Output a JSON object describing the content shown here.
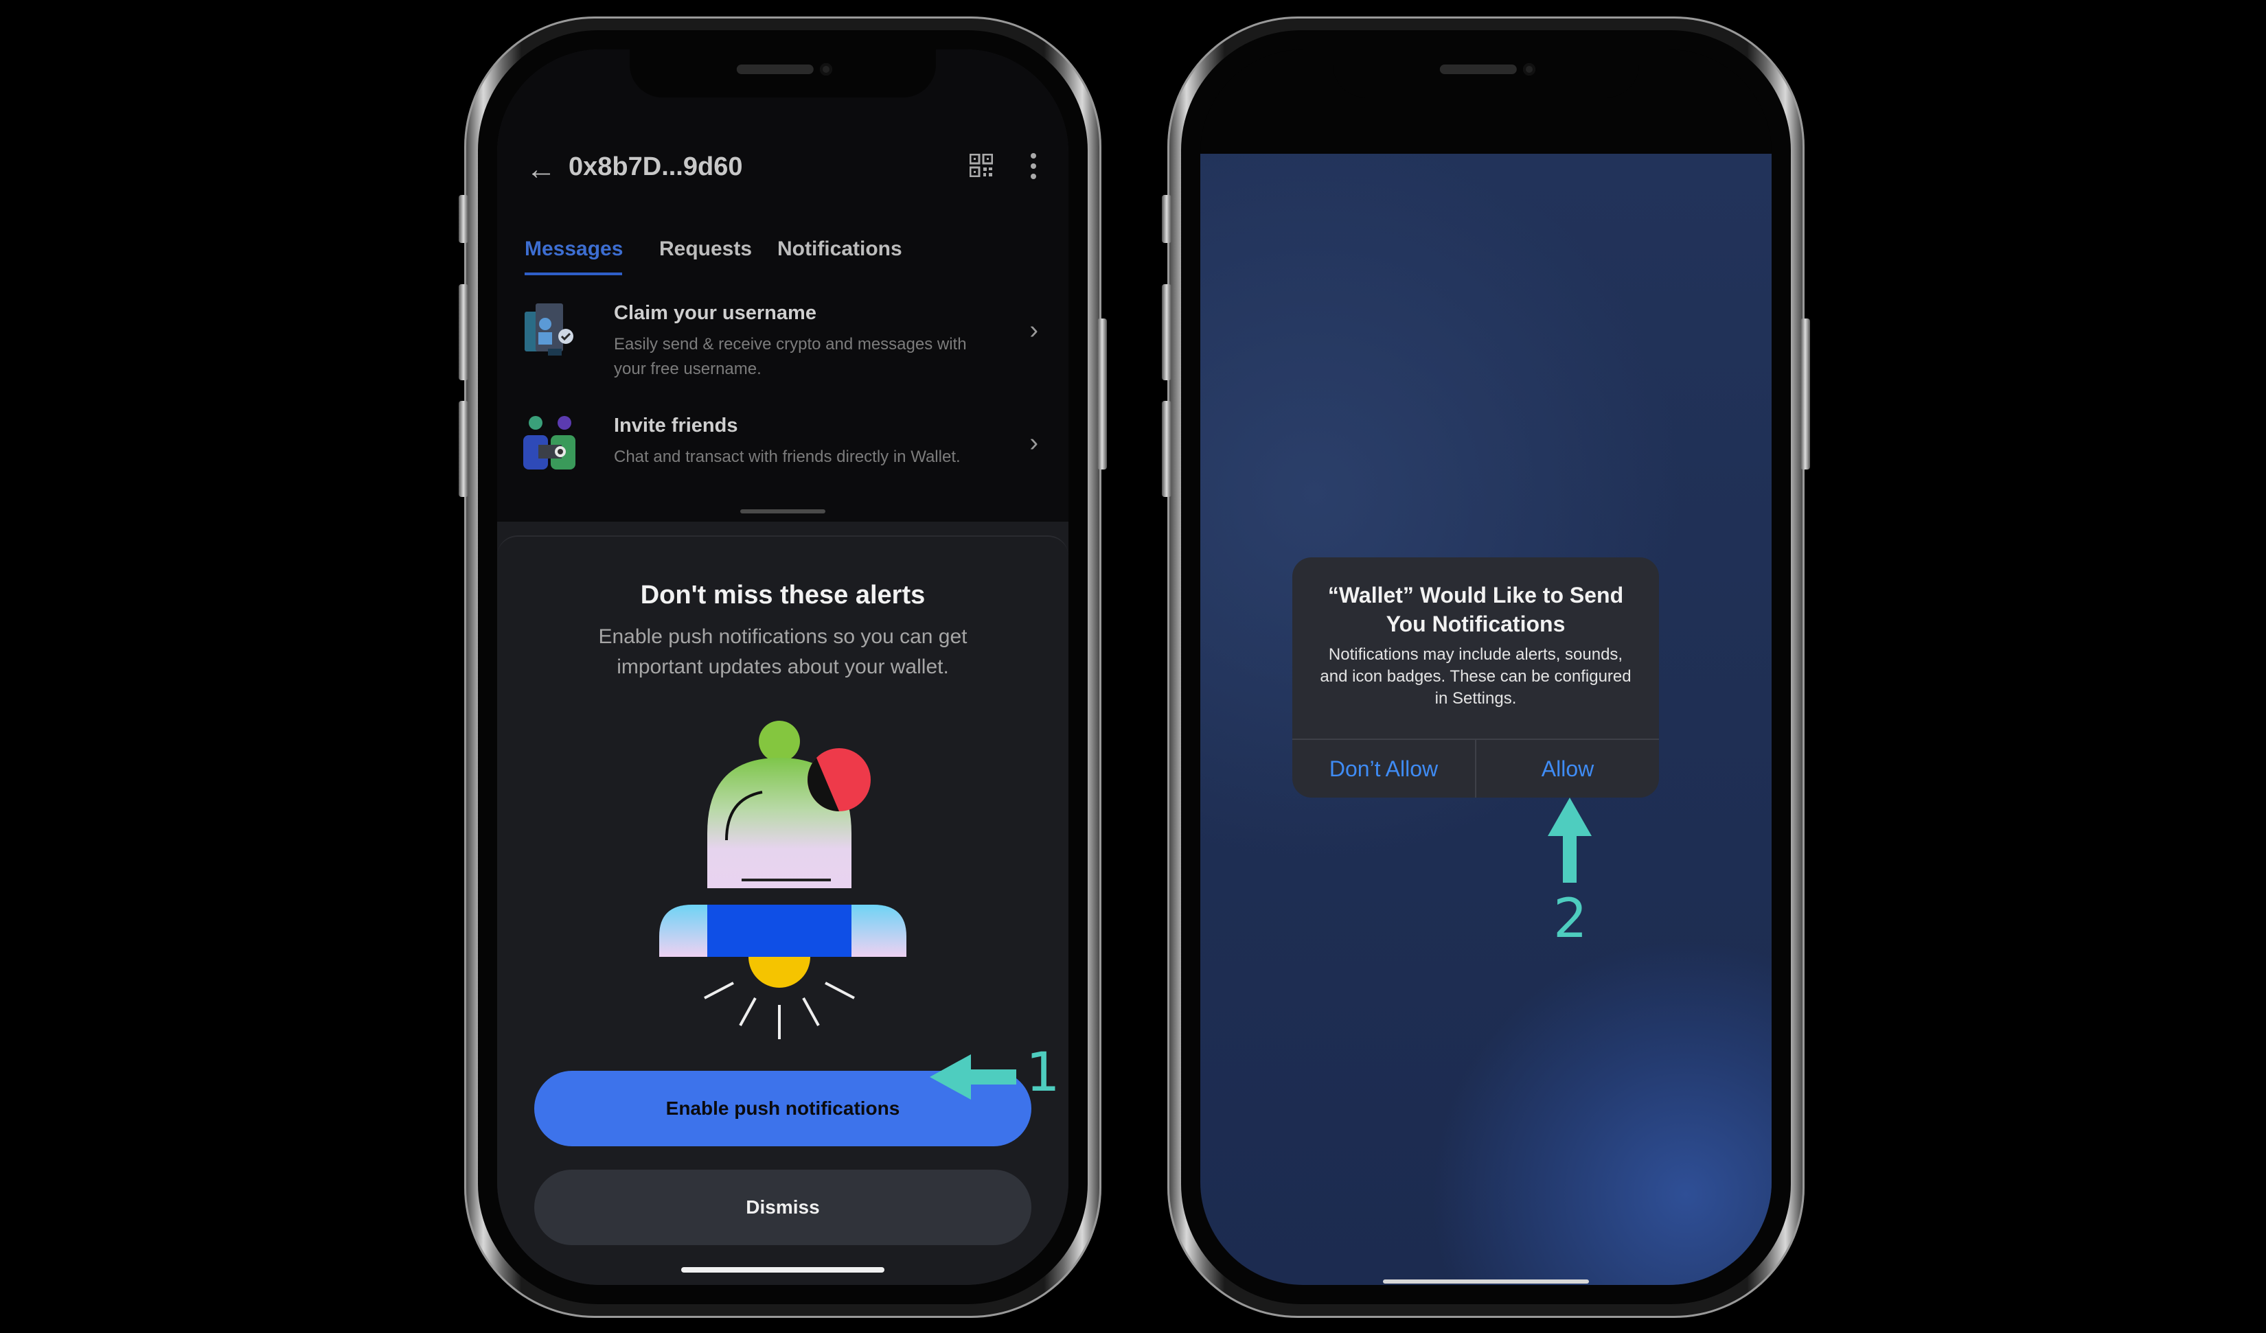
{
  "colors": {
    "accent": "#3d73eb",
    "annotation": "#4ecdbf",
    "ios_link": "#3f8cf5"
  },
  "left_phone": {
    "header": {
      "address": "0x8b7D...9d60",
      "back_icon": "back-arrow-icon",
      "qr_icon": "qr-code-icon",
      "more_icon": "more-vertical-icon"
    },
    "tabs": [
      {
        "label": "Messages",
        "active": true
      },
      {
        "label": "Requests",
        "active": false
      },
      {
        "label": "Notifications",
        "active": false
      }
    ],
    "list": [
      {
        "title": "Claim your username",
        "desc": "Easily send & receive crypto and messages with your free username."
      },
      {
        "title": "Invite friends",
        "desc": "Chat and transact with friends directly in Wallet."
      }
    ],
    "sheet": {
      "title": "Don't miss these alerts",
      "desc": "Enable push notifications so you can get important updates about your wallet.",
      "primary_button": "Enable push notifications",
      "secondary_button": "Dismiss"
    }
  },
  "right_phone": {
    "alert": {
      "title": "“Wallet” Would Like to Send You Notifications",
      "body": "Notifications may include alerts, sounds, and icon badges. These can be configured in Settings.",
      "deny_button": "Don’t Allow",
      "allow_button": "Allow"
    }
  },
  "annotations": {
    "step1": "1",
    "step2": "2"
  }
}
